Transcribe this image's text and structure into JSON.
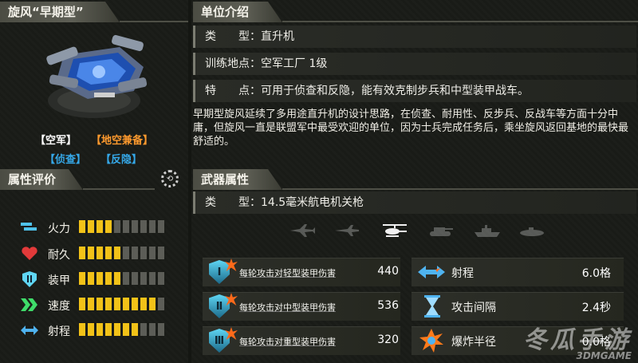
{
  "unit": {
    "name": "旋风“早期型”",
    "tags_row1": [
      "【空军】",
      "【地空兼备】"
    ],
    "tags_row2": [
      "【侦查】",
      "【反隐】"
    ]
  },
  "attr": {
    "header": "属性评价",
    "rows": [
      {
        "label": "火力",
        "icon": "firepower-icon",
        "rating": 4,
        "max": 10
      },
      {
        "label": "耐久",
        "icon": "heart-icon",
        "rating": 5,
        "max": 10
      },
      {
        "label": "装甲",
        "icon": "armor-shield-icon",
        "rating": 5,
        "max": 10
      },
      {
        "label": "速度",
        "icon": "speed-chevron-icon",
        "rating": 9,
        "max": 10
      },
      {
        "label": "射程",
        "icon": "range-arrows-icon",
        "rating": 7,
        "max": 10
      }
    ]
  },
  "intro": {
    "header": "单位介绍",
    "type_label": "类　　型：",
    "type_value": "直升机",
    "train_label": "训练地点：",
    "train_value": "空军工厂 1级",
    "feature_label": "特　　点：",
    "feature_value": "可用于侦查和反隐，能有效克制步兵和中型装甲战车。",
    "description": "早期型旋风延续了多用途直升机的设计思路，在侦查、耐用性、反步兵、反战车等方面十分中庸，但旋风一直是联盟军中最受欢迎的单位，因为士兵完成任务后，乘坐旋风返回基地的最快最舒适的。"
  },
  "weapon": {
    "header": "武器属性",
    "type_label": "类　　型：",
    "type_value": "14.5毫米航电机关枪",
    "target_icons": [
      "jet-icon",
      "plane-icon",
      "helicopter-icon",
      "tank-icon",
      "ship-icon",
      "submarine-icon"
    ],
    "selected_target": 2,
    "damage": [
      {
        "tier": "Ⅰ",
        "label": "每轮攻击对轻型装甲伤害",
        "value": "440"
      },
      {
        "tier": "Ⅱ",
        "label": "每轮攻击对中型装甲伤害",
        "value": "536"
      },
      {
        "tier": "Ⅲ",
        "label": "每轮攻击对重型装甲伤害",
        "value": "320"
      }
    ],
    "stats": [
      {
        "label": "射程",
        "icon": "range-arrows-icon",
        "value": "6.0格"
      },
      {
        "label": "攻击间隔",
        "icon": "hourglass-icon",
        "value": "2.4秒"
      },
      {
        "label": "爆炸半径",
        "icon": "explosion-icon",
        "value": "0.0格"
      }
    ]
  },
  "watermark": {
    "text1": "冬瓜手游",
    "text2": "3DMGAME"
  },
  "colors": {
    "accent_yellow": "#f2c218",
    "tag_orange": "#ff9a2e",
    "tag_blue": "#35a8e8",
    "shield_cyan": "#5fd6f4"
  }
}
